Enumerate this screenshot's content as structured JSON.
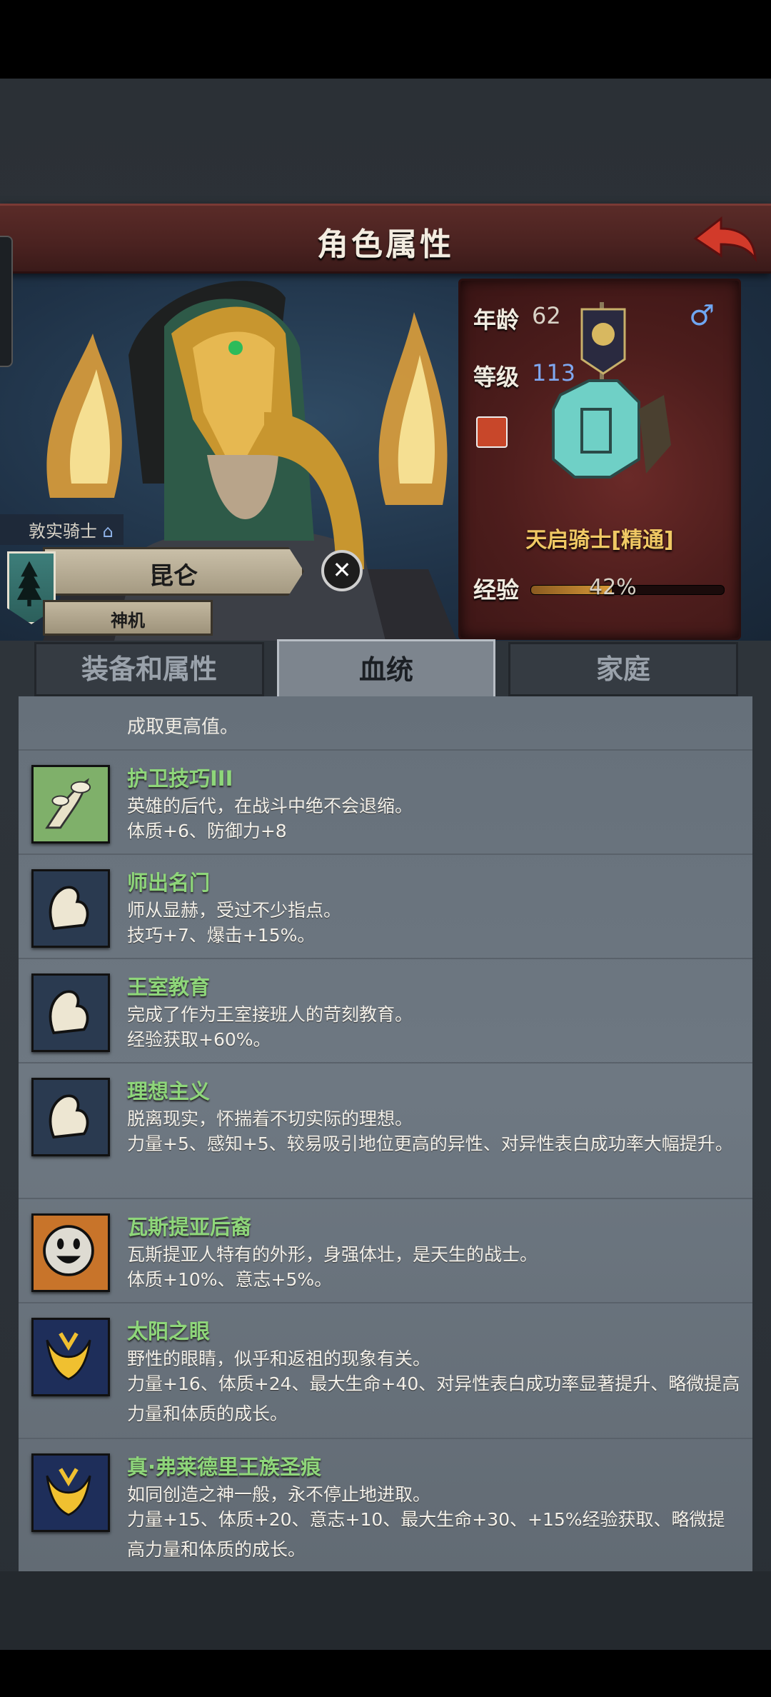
{
  "header": {
    "title": "角色属性"
  },
  "character": {
    "title": "敦实骑士",
    "name": "昆仑",
    "subtitle": "神机",
    "age_label": "年龄",
    "age": "62",
    "level_label": "等级",
    "level": "113",
    "gender_symbol": "♂",
    "class": "天启骑士[精通]",
    "exp_label": "经验",
    "exp_percent": "42%",
    "exp_value": 0.42
  },
  "tabs": [
    {
      "label": "装备和属性",
      "active": false
    },
    {
      "label": "血统",
      "active": true
    },
    {
      "label": "家庭",
      "active": false
    }
  ],
  "partial_text": "成取更高值。",
  "traits": [
    {
      "name": "护卫技巧III",
      "desc": "英雄的后代，在战斗中绝不会退缩。",
      "effect": "体质+6、防御力+8",
      "icon": "leaf-arm-icon"
    },
    {
      "name": "师出名门",
      "desc": "师从显赫，受过不少指点。",
      "effect": "技巧+7、爆击+15%。",
      "icon": "muscle-arm-icon"
    },
    {
      "name": "王室教育",
      "desc": "完成了作为王室接班人的苛刻教育。",
      "effect": "经验获取+60%。",
      "icon": "muscle-arm-icon"
    },
    {
      "name": "理想主义",
      "desc": "脱离现实，怀揣着不切实际的理想。",
      "effect": "力量+5、感知+5、较易吸引地位更高的异性、对异性表白成功率大幅提升。",
      "icon": "muscle-arm-icon"
    },
    {
      "name": "瓦斯提亚后裔",
      "desc": "瓦斯提亚人特有的外形，身强体壮，是天生的战士。",
      "effect": "体质+10%、意志+5%。",
      "icon": "smiley-face-icon"
    },
    {
      "name": "太阳之眼",
      "desc": "野性的眼睛，似乎和返祖的现象有关。",
      "effect": "力量+16、体质+24、最大生命+40、对异性表白成功率显著提升、略微提高力量和体质的成长。",
      "icon": "golden-eye-icon"
    },
    {
      "name": "真·弗莱德里王族圣痕",
      "desc": "如同创造之神一般，永不停止地进取。",
      "effect": "力量+15、体质+20、意志+10、最大生命+30、+15%经验获取、略微提高力量和体质的成长。",
      "icon": "golden-eye-icon"
    }
  ]
}
